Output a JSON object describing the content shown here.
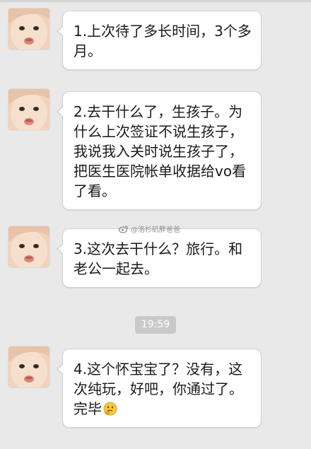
{
  "messages": [
    {
      "text": "1.上次待了多长时间，3个多月。"
    },
    {
      "text": "2.去干什么了，生孩子。为什么上次签证不说生孩子，我说我入关时说生孩子了，把医生医院帐单收据给vo看了看。"
    },
    {
      "text": "3.这次去干什么？旅行。和老公一起去。"
    },
    {
      "text": "4.这个怀宝宝了？没有，这次纯玩，好吧，你通过了。完毕"
    }
  ],
  "timestamp": "19:59",
  "watermark": "@洛杉矶胖爸爸",
  "icons": {
    "avatar": "baby-face-avatar",
    "emoji": "thinking-face-emoji",
    "watermark": "weibo-logo"
  }
}
